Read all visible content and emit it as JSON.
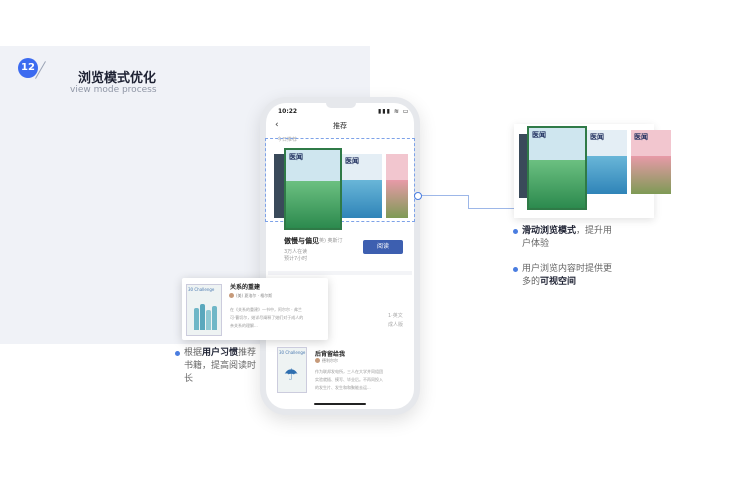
{
  "header": {
    "step_number": "12",
    "title": "浏览模式优化",
    "subtitle": "view mode process"
  },
  "phone": {
    "status_time": "10:22",
    "status_icons": "▮▮▮ ≋ ▭",
    "back_icon": "‹",
    "nav_title": "推荐",
    "section_label": "今日推荐",
    "cover_logo": "医闻",
    "featured_book": {
      "name": "傲慢与偏见",
      "author": "(英) 奥斯汀",
      "readers": "3万人在读",
      "time": "预计7小时",
      "read_button": "阅读"
    },
    "ghost_line1": "1·英文",
    "ghost_line2": "成人版"
  },
  "popout": {
    "cover_text": "30 Challenge",
    "title": "关系的重建",
    "author": "(美) 夏洛尔 · 格尔斯",
    "desc1": "在《关系的重建》一书中，阿尔尔 · 弗兰",
    "desc2": "可·曹切尔，她详尽阐释了她们对于成人的",
    "desc3": "亲关系的理解..."
  },
  "list_item2": {
    "cover_text": "30 Challenge",
    "umbrella_icon": "☂",
    "title": "后背留给我",
    "author": "德利尔尔",
    "desc1": "作为联邦发电所，三人在大学并同组团",
    "desc2": "实验就插、摸写、毕业后。不再同投入",
    "desc3": "的发生片、发生和和聚能去运...",
    "desc4": ""
  },
  "notes": {
    "right_top": {
      "prefix": "",
      "highlight": "滑动浏览模式",
      "suffix": "，提升用户体验"
    },
    "right_bottom": {
      "prefix": "用户浏览内容时提供更多的",
      "highlight": "可视空间",
      "suffix": ""
    },
    "left_bottom": {
      "prefix": "根据",
      "highlight": "用户习惯",
      "suffix": "推荐书籍，提高阅读时长"
    }
  },
  "colors": {
    "accent": "#3c6bf0",
    "button": "#3d5fb0",
    "connector": "#4a7de0"
  }
}
